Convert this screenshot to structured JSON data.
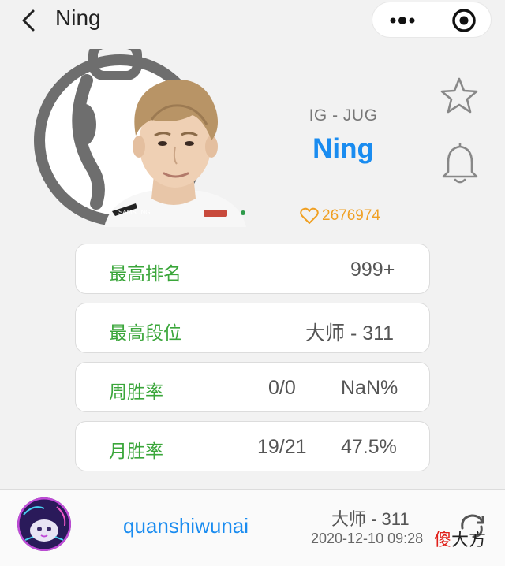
{
  "nav": {
    "title": "Ning",
    "back_icon": "chevron-left-icon",
    "more_icon": "more-dots-icon",
    "close_icon": "target-circle-icon"
  },
  "player": {
    "team_position": "IG - JUG",
    "name": "Ning",
    "likes": "2676974",
    "likes_icon": "heart-outline-icon",
    "favorite_icon": "star-outline-icon",
    "notify_icon": "bell-outline-icon",
    "jersey_text": "SAMSUNG"
  },
  "stats": [
    {
      "label": "最高排名",
      "value": "999+"
    },
    {
      "label": "最高段位",
      "value": "大师 - 311"
    },
    {
      "label": "周胜率",
      "record": "0/0",
      "rate": "NaN%"
    },
    {
      "label": "月胜率",
      "record": "19/21",
      "rate": "47.5%"
    }
  ],
  "account": {
    "username": "quanshiwunai",
    "rank": "大师 - 311",
    "updated": "2020-12-10 09:28",
    "refresh_icon": "refresh-icon"
  },
  "watermark": {
    "red": "傻",
    "black": "大方"
  },
  "colors": {
    "accent_blue": "#1a8cf0",
    "label_green": "#3aa63a",
    "likes_orange": "#f0a023",
    "watermark_red": "#e0201a"
  }
}
